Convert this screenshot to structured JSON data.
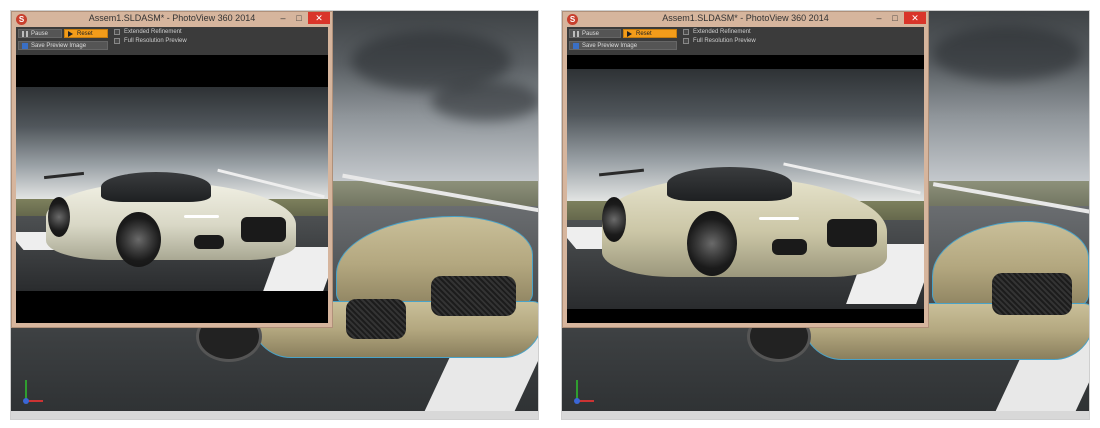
{
  "panels": [
    {
      "id": "left",
      "window": {
        "title": "Assem1.SLDASM* - PhotoView 360 2014",
        "minimize": "–",
        "maximize": "□",
        "close": "✕",
        "toolbar": {
          "pause_label": "Pause",
          "reset_label": "Reset",
          "save_preview_label": "Save Preview Image",
          "extended_refinement_label": "Extended Refinement",
          "full_resolution_label": "Full Resolution Preview"
        }
      }
    },
    {
      "id": "right",
      "window": {
        "title": "Assem1.SLDASM* - PhotoView 360 2014",
        "minimize": "–",
        "maximize": "□",
        "close": "✕",
        "toolbar": {
          "pause_label": "Pause",
          "reset_label": "Reset",
          "save_preview_label": "Save Preview Image",
          "extended_refinement_label": "Extended Refinement",
          "full_resolution_label": "Full Resolution Preview"
        }
      }
    }
  ],
  "icons": {
    "app": "photoview-app-icon",
    "pause": "pause-icon",
    "reset": "play-triangle-icon",
    "save": "floppy-disk-icon",
    "axis": "coordinate-triad-icon"
  },
  "colors": {
    "reset_button": "#f39c1a",
    "close_button": "#d9352a",
    "window_frame": "#d6b59d",
    "cad_edge": "#4aa3c8"
  }
}
